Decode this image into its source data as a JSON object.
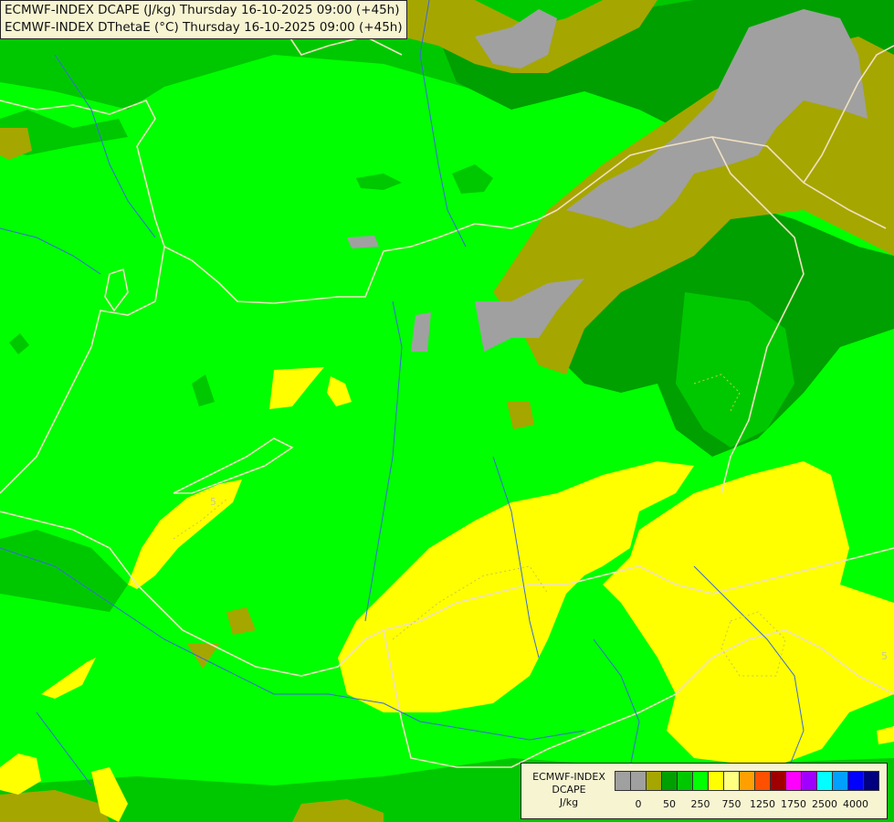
{
  "header": {
    "line1": "ECMWF-INDEX DCAPE (J/kg) Thursday 16-10-2025 09:00 (+45h)",
    "line2": "ECMWF-INDEX DThetaE (°C) Thursday 16-10-2025 09:00 (+45h)"
  },
  "map": {
    "contour_labels": [
      {
        "text": "5"
      },
      {
        "text": "5"
      }
    ]
  },
  "legend": {
    "title_line1": "ECMWF-INDEX",
    "title_line2": "DCAPE",
    "unit": "J/kg",
    "colors": [
      "#a0a0a0",
      "#a0a0a0",
      "#a6a600",
      "#00a000",
      "#00c800",
      "#00ff00",
      "#ffff00",
      "#ffff80",
      "#ffa000",
      "#ff5000",
      "#a00000",
      "#ff00ff",
      "#a000ff",
      "#00ffff",
      "#00a0ff",
      "#0000ff",
      "#000080"
    ],
    "tick_labels": [
      "0",
      "50",
      "250",
      "750",
      "1250",
      "1750",
      "2500",
      "4000"
    ]
  },
  "colors": {
    "grey": "#a0a0a0",
    "olive": "#a6a600",
    "dark_green": "#00a000",
    "medium_green": "#00c800",
    "bright_green": "#00ff00",
    "yellow": "#ffff00",
    "border": "#f0e0c0",
    "river": "#3a6ad8"
  }
}
